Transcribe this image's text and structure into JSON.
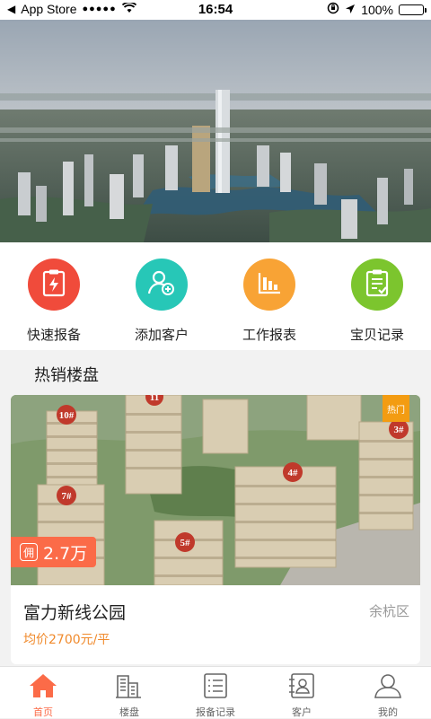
{
  "status_bar": {
    "carrier": "App Store",
    "signal": "●●●●●",
    "time": "16:54",
    "battery": "100%"
  },
  "quick_actions": [
    {
      "label": "快速报备",
      "icon": "clipboard-lightning-icon",
      "color": "#f04b3b"
    },
    {
      "label": "添加客户",
      "icon": "add-user-icon",
      "color": "#27c7b7"
    },
    {
      "label": "工作报表",
      "icon": "bar-chart-icon",
      "color": "#f8a335"
    },
    {
      "label": "宝贝记录",
      "icon": "checklist-icon",
      "color": "#7cc52e"
    }
  ],
  "hot_section": {
    "title": "热销楼盘"
  },
  "listing": {
    "badge": "热门",
    "commission_tag": "佣",
    "commission_value": "2.7万",
    "name": "富力新线公园",
    "district": "余杭区",
    "price": "均价2700元/平",
    "building_numbers": [
      "10#",
      "11",
      "3#",
      "4#",
      "7#",
      "5#"
    ]
  },
  "tabbar": {
    "items": [
      {
        "label": "首页",
        "icon": "home-icon",
        "active": true
      },
      {
        "label": "楼盘",
        "icon": "buildings-icon",
        "active": false
      },
      {
        "label": "报备记录",
        "icon": "list-icon",
        "active": false
      },
      {
        "label": "客户",
        "icon": "contact-card-icon",
        "active": false
      },
      {
        "label": "我的",
        "icon": "user-icon",
        "active": false
      }
    ]
  },
  "colors": {
    "accent": "#fb6b48",
    "price": "#f08a2c",
    "hot_badge": "#f39c12"
  }
}
